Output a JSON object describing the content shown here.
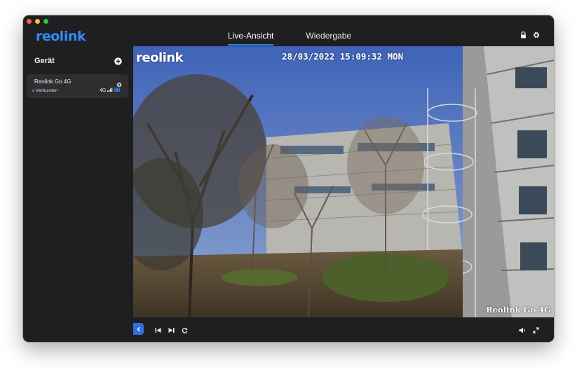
{
  "app": {
    "logo": "reolink"
  },
  "tabs": [
    {
      "label": "Live-Ansicht",
      "active": true
    },
    {
      "label": "Wiedergabe",
      "active": false
    }
  ],
  "header_icons": [
    "lock-icon",
    "gear-icon"
  ],
  "sidebar": {
    "title": "Gerät",
    "devices": [
      {
        "name": "Reolink Go 4G",
        "status": "Verbunden",
        "network": "4G"
      }
    ]
  },
  "video": {
    "osd_logo": "reolink",
    "timestamp": "28/03/2022 15:09:32 MON",
    "camera_label": "Reolink Go 4G"
  },
  "controls": {
    "left": [
      "collapse-sidebar-icon",
      "previous-icon",
      "next-icon",
      "refresh-icon"
    ],
    "right": [
      "volume-icon",
      "fullscreen-icon"
    ]
  },
  "colors": {
    "accent": "#2f8cf5",
    "window_bg": "#1f1f21",
    "card_bg": "#2e2e31"
  }
}
